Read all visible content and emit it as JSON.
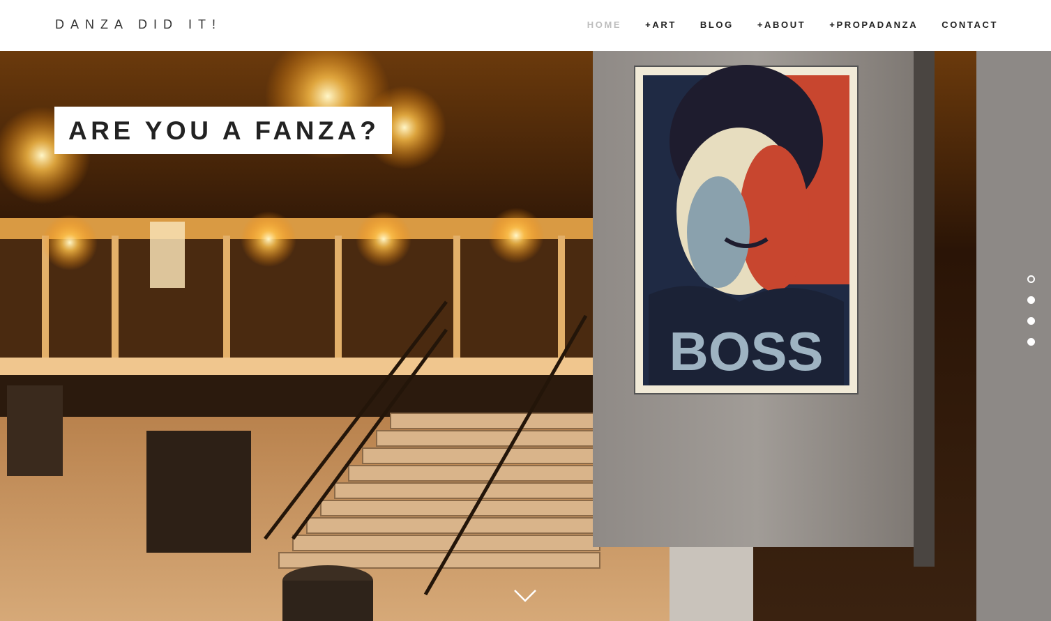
{
  "header": {
    "logo": "DANZA DID IT!",
    "nav": [
      {
        "label": "HOME",
        "active": true
      },
      {
        "label": "+ART",
        "active": false
      },
      {
        "label": "BLOG",
        "active": false
      },
      {
        "label": "+ABOUT",
        "active": false
      },
      {
        "label": "+PROPADANZA",
        "active": false
      },
      {
        "label": "CONTACT",
        "active": false
      }
    ]
  },
  "hero": {
    "headline": "ARE YOU A FANZA?",
    "poster_text": "BOSS",
    "slides": {
      "count": 4,
      "active_index": 0
    },
    "scroll_icon": "chevron-down-icon"
  }
}
